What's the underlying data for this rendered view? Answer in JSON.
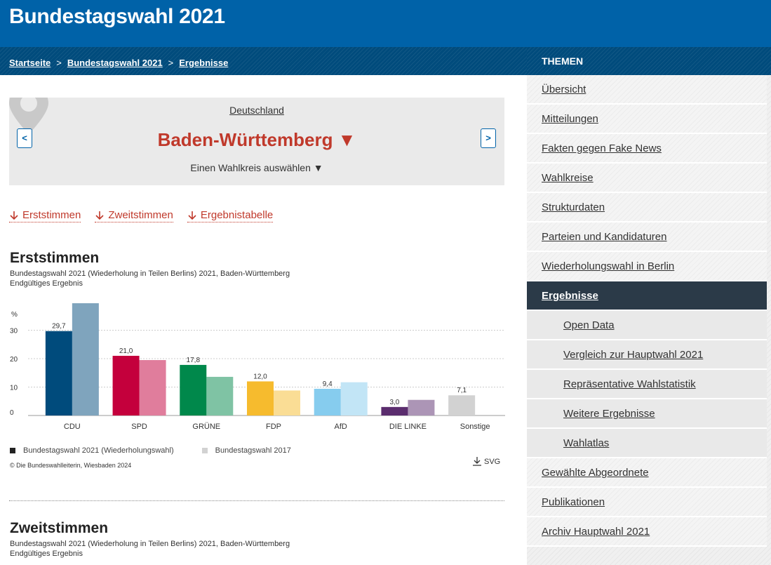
{
  "header": {
    "title": "Bundestagswahl 2021"
  },
  "breadcrumb": [
    {
      "label": "Startseite"
    },
    {
      "label": "Bundestagswahl 2021"
    },
    {
      "label": "Ergebnisse"
    }
  ],
  "breadcrumb_sep": ">",
  "selector": {
    "country": "Deutschland",
    "state": "Baden-Württemberg ▼",
    "wahlkreis": "Einen Wahlkreis auswählen ▼",
    "prev": "<",
    "next": ">"
  },
  "anchors": [
    "Erststimmen",
    "Zweitstimmen",
    "Ergebnistabelle"
  ],
  "erststimmen": {
    "title": "Erststimmen",
    "subtitle1": "Bundestagswahl 2021 (Wiederholung in Teilen Berlins) 2021, Baden-Württemberg",
    "subtitle2": "Endgültiges Ergebnis"
  },
  "chart_data": {
    "type": "bar",
    "ylabel": "%",
    "ylim": [
      0,
      40
    ],
    "yticks": [
      0,
      10,
      20,
      30
    ],
    "grid": true,
    "categories": [
      "CDU",
      "SPD",
      "GRÜNE",
      "FDP",
      "AfD",
      "DIE LINKE",
      "Sonstige"
    ],
    "series": [
      {
        "name": "Bundestagswahl 2021 (Wiederholungswahl)",
        "values": [
          29.7,
          21.0,
          17.8,
          12.0,
          9.4,
          3.0,
          7.1
        ],
        "labels": [
          "29,7",
          "21,0",
          "17,8",
          "12,0",
          "9,4",
          "3,0",
          "7,1"
        ]
      },
      {
        "name": "Bundestagswahl 2017",
        "values": [
          39.5,
          19.5,
          13.6,
          8.8,
          11.7,
          5.5,
          null
        ]
      }
    ],
    "colors": [
      "#004b7c",
      "#c4003c",
      "#00884b",
      "#f6bb2e",
      "#86ccee",
      "#5b2d6e",
      "#d2d2d2"
    ],
    "colors_prev": [
      "#7fa4bd",
      "#e07d9c",
      "#7fc3a4",
      "#fadd95",
      "#c2e5f6",
      "#ac95b6",
      "#d2d2d2"
    ],
    "legend_colors": [
      "#222222",
      "#d2d2d2"
    ]
  },
  "copyright": "© Die Bundeswahlleiterin, Wiesbaden 2024",
  "svg_download": "SVG",
  "zweitstimmen": {
    "title": "Zweitstimmen",
    "subtitle1": "Bundestagswahl 2021 (Wiederholung in Teilen Berlins) 2021, Baden-Württemberg",
    "subtitle2": "Endgültiges Ergebnis"
  },
  "sidebar": {
    "heading": "THEMEN",
    "items": [
      {
        "label": "Übersicht",
        "type": "top"
      },
      {
        "label": "Mitteilungen",
        "type": "top"
      },
      {
        "label": "Fakten gegen Fake News",
        "type": "top"
      },
      {
        "label": "Wahlkreise",
        "type": "top"
      },
      {
        "label": "Strukturdaten",
        "type": "top"
      },
      {
        "label": "Parteien und Kandidaturen",
        "type": "top"
      },
      {
        "label": "Wiederholungswahl in Berlin",
        "type": "top"
      },
      {
        "label": "Ergebnisse",
        "type": "active"
      },
      {
        "label": "Open Data",
        "type": "sub"
      },
      {
        "label": "Vergleich zur Hauptwahl 2021",
        "type": "sub"
      },
      {
        "label": "Repräsentative Wahlstatistik",
        "type": "sub"
      },
      {
        "label": "Weitere Ergebnisse",
        "type": "sub"
      },
      {
        "label": "Wahlatlas",
        "type": "sub"
      },
      {
        "label": "Gewählte Abgeordnete",
        "type": "top"
      },
      {
        "label": "Publikationen",
        "type": "top"
      },
      {
        "label": "Archiv Hauptwahl 2021",
        "type": "top"
      }
    ]
  }
}
